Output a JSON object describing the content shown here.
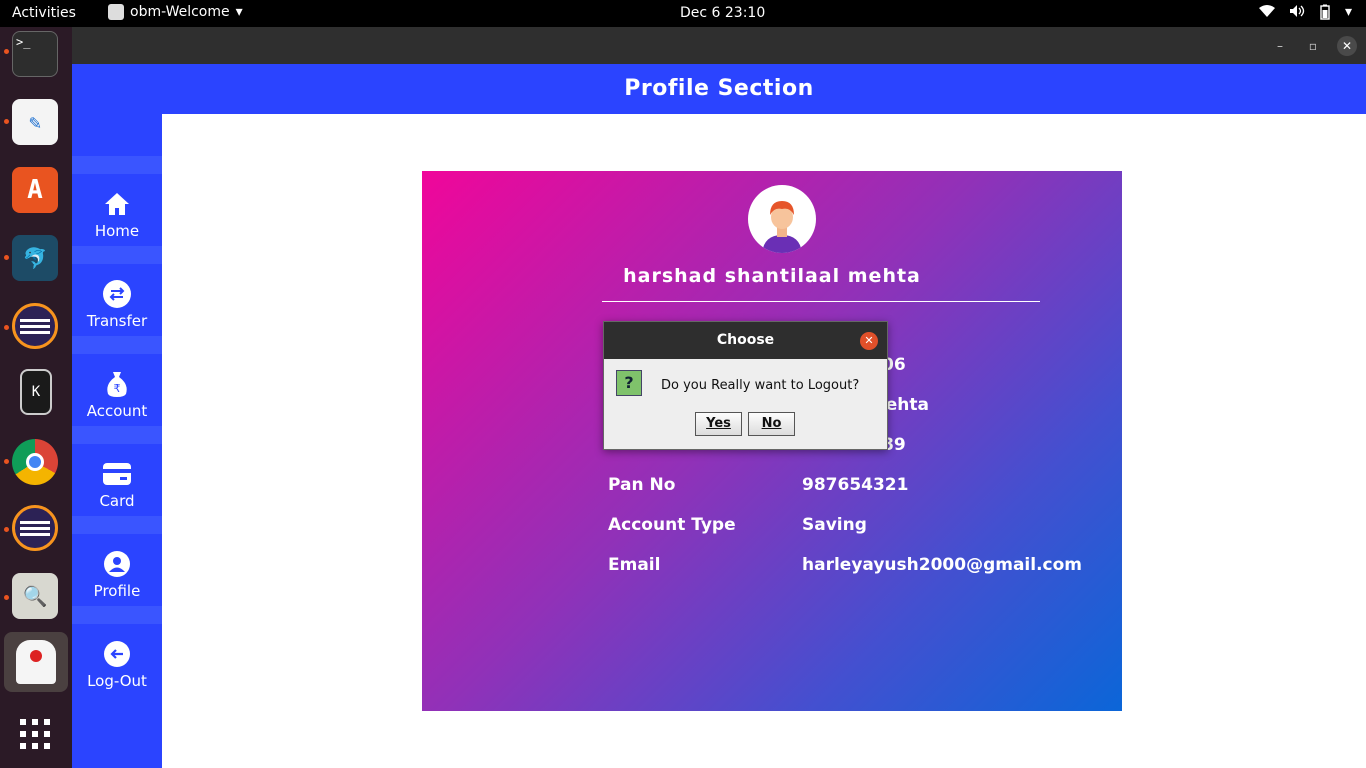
{
  "topbar": {
    "activities": "Activities",
    "app_name": "obm-Welcome",
    "clock": "Dec 6  23:10"
  },
  "dock": {
    "apps": [
      "terminal-icon",
      "text-editor-icon",
      "software-store-icon",
      "mysql-workbench-icon",
      "eclipse-icon",
      "kde-connect-icon",
      "chrome-icon",
      "eclipse-icon",
      "image-viewer-icon",
      "java-duke-icon",
      "app-grid-icon"
    ]
  },
  "window": {
    "header_title": "Profile Section",
    "minimize": "–",
    "maximize": "▫",
    "close": "✕"
  },
  "sidebar": {
    "items": [
      {
        "label": "Home",
        "icon": "home-icon"
      },
      {
        "label": "Transfer",
        "icon": "transfer-icon"
      },
      {
        "label": "Account",
        "icon": "money-bag-icon"
      },
      {
        "label": "Card",
        "icon": "card-icon"
      },
      {
        "label": "Profile",
        "icon": "profile-icon"
      },
      {
        "label": "Log-Out",
        "icon": "logout-icon"
      }
    ]
  },
  "profile": {
    "name": "harshad shantilaal mehta",
    "visible_fragments": [
      "06",
      "mehta",
      "89"
    ],
    "pan_label": "Pan No",
    "pan_value": "987654321",
    "account_type_label": "Account Type",
    "account_type_value": "Saving",
    "email_label": "Email",
    "email_value": "harleyayush2000@gmail.com"
  },
  "dialog": {
    "title": "Choose",
    "message": "Do you Really want to Logout?",
    "yes": "Yes",
    "no": "No",
    "icon": "?"
  },
  "colors": {
    "accent": "#2b44ff",
    "card_gradient_start": "#f0069a",
    "card_gradient_end": "#0b66d8"
  }
}
